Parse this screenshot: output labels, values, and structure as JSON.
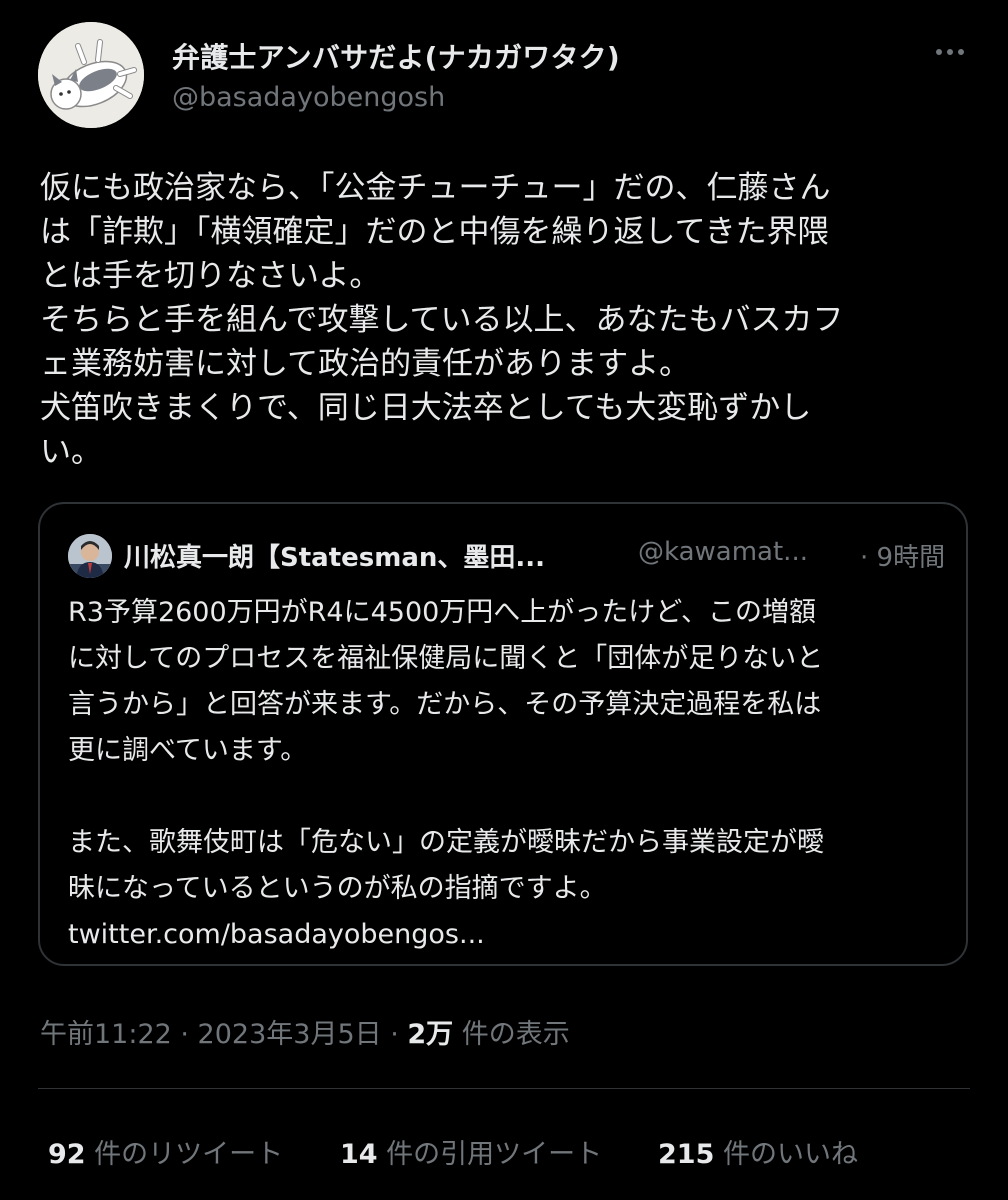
{
  "author": {
    "display_name": "弁護士アンバサだよ(ナカガワタク)",
    "handle": "@basadayobengosh"
  },
  "tweet": {
    "lines": [
      "仮にも政治家なら、「公金チューチュー」だの、仁藤さん",
      "は「詐欺」「横領確定」だのと中傷を繰り返してきた界隈",
      "とは手を切りなさいよ。",
      "そちらと手を組んで攻撃している以上、あなたもバスカフ",
      "ェ業務妨害に対して政治的責任がありますよ。",
      "犬笛吹きまくりで、同じ日大法卒としても大変恥ずかし",
      "い。"
    ]
  },
  "quote": {
    "display_name": "川松真一朗【Statesman、墨田...",
    "handle": "@kawamat...",
    "time": "· 9時間",
    "paragraph1": [
      "R3予算2600万円がR4に4500万円へ上がったけど、この増額",
      "に対してのプロセスを福祉保健局に聞くと「団体が足りないと",
      "言うから」と回答が来ます。だから、その予算決定過程を私は",
      "更に調べています。"
    ],
    "paragraph2": [
      "また、歌舞伎町は「危ない」の定義が曖昧だから事業設定が曖",
      "昧になっているというのが私の指摘ですよ。"
    ],
    "link": "twitter.com/basadayobengos..."
  },
  "meta": {
    "timestamp": "午前11:22 · 2023年3月5日 · ",
    "views_count": "2万",
    "views_label": " 件の表示"
  },
  "stats": {
    "retweets_count": "92",
    "retweets_label": " 件のリツイート",
    "quotes_count": "14",
    "quotes_label": " 件の引用ツイート",
    "likes_count": "215",
    "likes_label": " 件のいいね"
  },
  "icons": {
    "more": "more-horizontal-icon",
    "avatar": "cat-avatar",
    "quote_avatar": "person-avatar"
  },
  "colors": {
    "background": "#000000",
    "text_primary": "#e7e9ea",
    "text_secondary": "#71767b",
    "border": "#2f3336"
  }
}
